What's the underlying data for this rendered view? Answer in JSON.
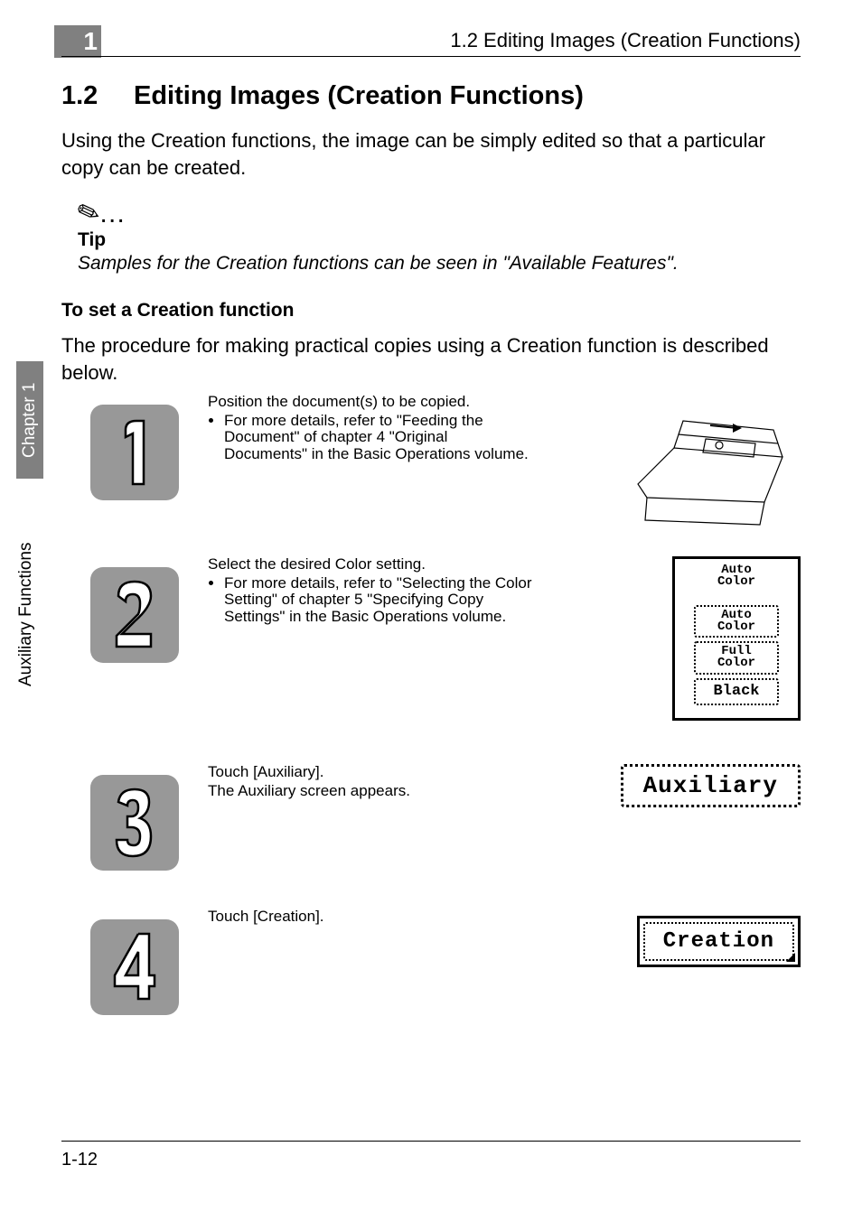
{
  "header": {
    "chapter_number": "1",
    "running_title": "1.2 Editing Images (Creation Functions)"
  },
  "side": {
    "chapter_label": "Chapter 1",
    "section_label": "Auxiliary Functions"
  },
  "section": {
    "number": "1.2",
    "title": "Editing Images (Creation Functions)",
    "intro": "Using the Creation functions, the image can be simply edited so that a particular copy can be created."
  },
  "tip": {
    "label": "Tip",
    "text": "Samples for the Creation functions can be seen in \"Available Features\"."
  },
  "procedure": {
    "heading": "To set a Creation function",
    "intro": "The procedure for making practical copies using a Creation function is described below."
  },
  "steps": [
    {
      "num": "1",
      "lead": "Position the document(s) to be copied.",
      "bullet": "For more details, refer to \"Feeding the Document\" of chapter 4 \"Original Documents\" in the Basic Operations volume.",
      "illustration": "copier-line-art"
    },
    {
      "num": "2",
      "lead": "Select the desired Color setting.",
      "bullet": "For more details, refer to \"Selecting the Color Setting\" of chapter 5 \"Specifying Copy Settings\" in the Basic Operations volume.",
      "color_panel": {
        "header_line1": "Auto",
        "header_line2": "Color",
        "options": [
          {
            "line1": "Auto",
            "line2": "Color"
          },
          {
            "line1": "Full",
            "line2": "Color"
          },
          {
            "single": "Black"
          }
        ]
      }
    },
    {
      "num": "3",
      "lead": "Touch [Auxiliary].",
      "extra": "The Auxiliary screen appears.",
      "button_label": "Auxiliary"
    },
    {
      "num": "4",
      "lead": "Touch [Creation].",
      "button_label": "Creation"
    }
  ],
  "footer": {
    "page_number": "1-12"
  }
}
